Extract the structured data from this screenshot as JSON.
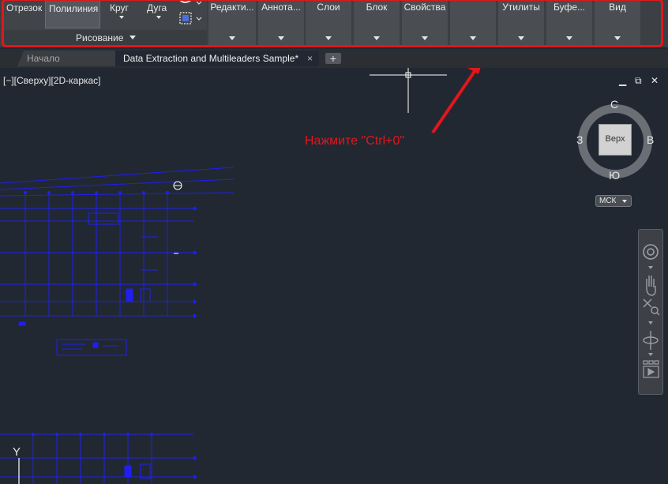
{
  "ribbon": {
    "draw_tools": {
      "line": "Отрезок",
      "polyline": "Полилиния",
      "circle": "Круг",
      "arc": "Дуга"
    },
    "draw_panel_title": "Рисование",
    "panels": [
      "Редакти...",
      "Аннота...",
      "Слои",
      "Блок",
      "Свойства",
      "",
      "Утилиты",
      "Буфе...",
      "Вид"
    ]
  },
  "tabs": {
    "start": "Начало",
    "document": "Data Extraction and Multileaders Sample*",
    "close_glyph": "×",
    "new_glyph": "+"
  },
  "viewport": {
    "view_controls": "[−][Сверху][2D-каркас]",
    "window_controls": {
      "minimize": "▁",
      "restore": "⧉",
      "close": "✕"
    },
    "viewcube": {
      "north": "С",
      "south": "Ю",
      "west": "З",
      "east": "В",
      "face": "Верх"
    },
    "wcs_label": "МСК",
    "ucs_y_label": "Y",
    "annotation": "Нажмите \"Ctrl+0\"",
    "colors": {
      "drawing": "#1f1ff0",
      "annotation": "#e0171b",
      "frame": "#e0171b"
    }
  }
}
